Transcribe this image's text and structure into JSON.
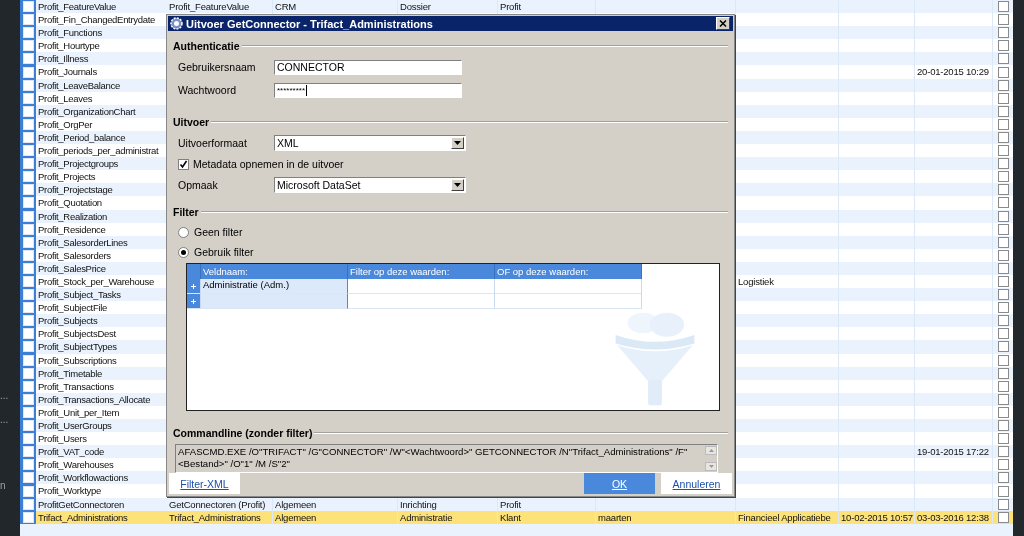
{
  "left_panel": {
    "texts": [
      "...",
      "...",
      "n"
    ]
  },
  "grid": {
    "rows": [
      {
        "name": "Profit_FeatureValue",
        "checked": false,
        "column_10_checked": false,
        "selected": false,
        "column_2": "Profit_FeatureValue",
        "column_3": "CRM",
        "column_4": "Dossier",
        "column_5": "Profit"
      },
      {
        "name": "Profit_Fin_ChangedEntrydate",
        "checked": false,
        "column_10_checked": false,
        "selected": false
      },
      {
        "name": "Profit_Functions",
        "checked": false,
        "column_10_checked": false,
        "selected": false
      },
      {
        "name": "Profit_Hourtype",
        "checked": false,
        "column_10_checked": false,
        "selected": false
      },
      {
        "name": "Profit_Illness",
        "checked": false,
        "column_10_checked": false,
        "selected": false
      },
      {
        "name": "Profit_Journals",
        "checked": false,
        "column_10_checked": false,
        "selected": false,
        "column_9": "20-01-2015 10:29"
      },
      {
        "name": "Profit_LeaveBalance",
        "checked": false,
        "column_10_checked": false,
        "selected": false
      },
      {
        "name": "Profit_Leaves",
        "checked": false,
        "column_10_checked": false,
        "selected": false
      },
      {
        "name": "Profit_OrganizationChart",
        "checked": false,
        "column_10_checked": false,
        "selected": false
      },
      {
        "name": "Profit_OrgPer",
        "checked": false,
        "column_10_checked": false,
        "selected": false
      },
      {
        "name": "Profit_Period_balance",
        "checked": false,
        "column_10_checked": false,
        "selected": false
      },
      {
        "name": "Profit_periods_per_administrat",
        "checked": false,
        "column_10_checked": false,
        "selected": false
      },
      {
        "name": "Profit_Projectgroups",
        "checked": false,
        "column_10_checked": false,
        "selected": false
      },
      {
        "name": "Profit_Projects",
        "checked": false,
        "column_10_checked": false,
        "selected": false
      },
      {
        "name": "Profit_Projectstage",
        "checked": false,
        "column_10_checked": false,
        "selected": false
      },
      {
        "name": "Profit_Quotation",
        "checked": false,
        "column_10_checked": false,
        "selected": false
      },
      {
        "name": "Profit_Realization",
        "checked": false,
        "column_10_checked": false,
        "selected": false
      },
      {
        "name": "Profit_Residence",
        "checked": false,
        "column_10_checked": false,
        "selected": false
      },
      {
        "name": "Profit_SalesorderLines",
        "checked": false,
        "column_10_checked": false,
        "selected": false
      },
      {
        "name": "Profit_Salesorders",
        "checked": false,
        "column_10_checked": false,
        "selected": false
      },
      {
        "name": "Profit_SalesPrice",
        "checked": false,
        "column_10_checked": false,
        "selected": false
      },
      {
        "name": "Profit_Stock_per_Warehouse",
        "checked": false,
        "column_10_checked": false,
        "selected": false,
        "column_7": "Logistiek"
      },
      {
        "name": "Profit_Subject_Tasks",
        "checked": false,
        "column_10_checked": false,
        "selected": false
      },
      {
        "name": "Profit_SubjectFile",
        "checked": false,
        "column_10_checked": false,
        "selected": false
      },
      {
        "name": "Profit_Subjects",
        "checked": false,
        "column_10_checked": false,
        "selected": false
      },
      {
        "name": "Profit_SubjectsDest",
        "checked": false,
        "column_10_checked": false,
        "selected": false
      },
      {
        "name": "Profit_SubjectTypes",
        "checked": false,
        "column_10_checked": false,
        "selected": false
      },
      {
        "name": "Profit_Subscriptions",
        "checked": false,
        "column_10_checked": false,
        "selected": false
      },
      {
        "name": "Profit_Timetable",
        "checked": false,
        "column_10_checked": false,
        "selected": false
      },
      {
        "name": "Profit_Transactions",
        "checked": false,
        "column_10_checked": false,
        "selected": false
      },
      {
        "name": "Profit_Transactions_Allocate",
        "checked": false,
        "column_10_checked": false,
        "selected": false
      },
      {
        "name": "Profit_Unit_per_Item",
        "checked": false,
        "column_10_checked": false,
        "selected": false
      },
      {
        "name": "Profit_UserGroups",
        "checked": false,
        "column_10_checked": false,
        "selected": false
      },
      {
        "name": "Profit_Users",
        "checked": false,
        "column_10_checked": false,
        "selected": false
      },
      {
        "name": "Profit_VAT_code",
        "checked": false,
        "column_10_checked": false,
        "selected": false,
        "column_9": "19-01-2015 17:22"
      },
      {
        "name": "Profit_Warehouses",
        "checked": false,
        "column_10_checked": false,
        "selected": false
      },
      {
        "name": "Profit_Workflowactions",
        "checked": false,
        "column_10_checked": false,
        "selected": false
      },
      {
        "name": "Profit_Worktype",
        "checked": false,
        "column_10_checked": false,
        "selected": false
      },
      {
        "name": "ProfitGetConnectoren",
        "checked": false,
        "column_10_checked": false,
        "selected": false,
        "column_2": "GetConnectoren (Profit)",
        "column_3": "Algemeen",
        "column_4": "Inrichting",
        "column_5": "Profit"
      },
      {
        "name": "Trifact_Administrations",
        "checked": false,
        "column_10_checked": false,
        "selected": true,
        "column_2": "Trifact_Administrations",
        "column_3": "Algemeen",
        "column_4": "Administratie",
        "column_5": "Klant",
        "column_6": "maarten",
        "column_7": "Financieel Applicatiebe",
        "column_8": "10-02-2015 10:57",
        "column_9": "03-03-2016 12:38"
      }
    ]
  },
  "dialog": {
    "title": "Uitvoer GetConnector - Trifact_Administrations",
    "authentication": {
      "heading": "Authenticatie",
      "fields": [
        {
          "label": "Gebruikersnaam",
          "value": "CONNECTOR",
          "kind": "text"
        },
        {
          "label": "Wachtwoord",
          "value": "*********",
          "kind": "password"
        }
      ]
    },
    "output": {
      "heading": "Uitvoer",
      "format": {
        "label": "Uitvoerformaat",
        "value": "XML"
      },
      "metadata": {
        "label": "Metadata opnemen in de uitvoer",
        "checked": true
      },
      "layout": {
        "label": "Opmaak",
        "value": "Microsoft DataSet"
      }
    },
    "filter": {
      "heading": "Filter",
      "options": [
        {
          "label": "Geen filter",
          "selected": false
        },
        {
          "label": "Gebruik filter",
          "selected": true
        }
      ],
      "table": {
        "columns": [
          "Veldnaam:",
          "Filter op deze waarden:",
          "OF op deze waarden:"
        ],
        "rows": [
          {
            "kind": "filled",
            "cells": [
              "Administratie (Adm.)"
            ]
          },
          {
            "kind": "new"
          }
        ]
      }
    },
    "commandline": {
      "heading": "Commandline (zonder filter)",
      "text": "AFASCMD.EXE /O\"TRIFACT\" /G\"CONNECTOR\" /W\"<Wachtwoord>\" GETCONNECTOR /N\"Trifact_Administrations\" /F\"<Bestand>\" /O\"1\" /M /S\"2\""
    },
    "buttons": [
      {
        "label": "Filter-XML",
        "kind": "secondary"
      },
      {
        "label": "OK",
        "kind": "default"
      },
      {
        "label": "Annuleren",
        "kind": "secondary"
      }
    ]
  }
}
